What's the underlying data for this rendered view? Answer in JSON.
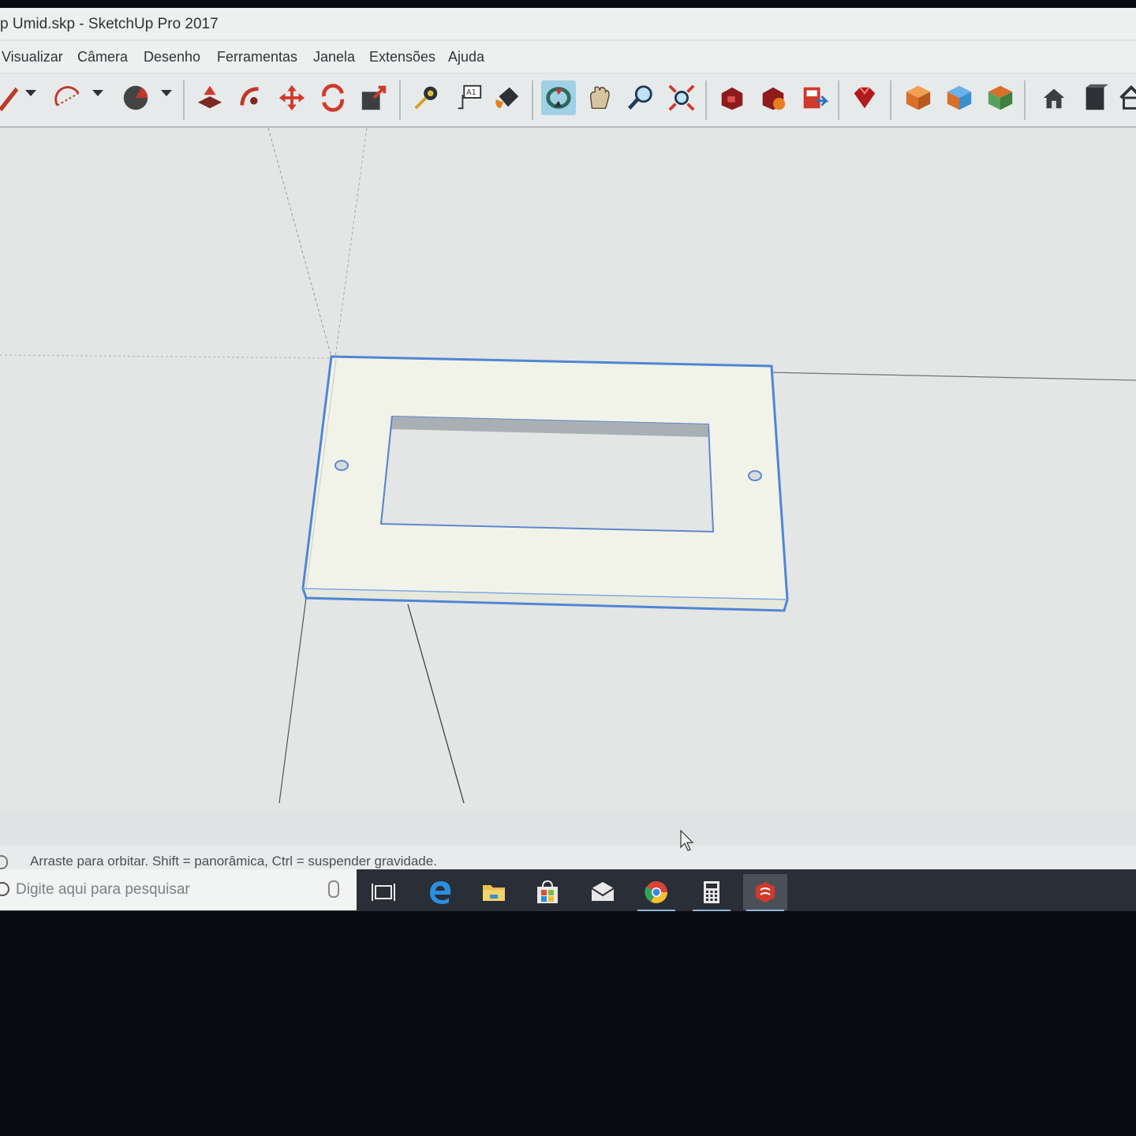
{
  "window": {
    "title": "p Umid.skp - SketchUp Pro 2017"
  },
  "menu": {
    "items": [
      "Visualizar",
      "Câmera",
      "Desenho",
      "Ferramentas",
      "Janela",
      "Extensões",
      "Ajuda"
    ]
  },
  "toolbar": {
    "tools": [
      "pencil-icon",
      "arc-icon",
      "pie-icon",
      "push-pull-icon",
      "follow-me-icon",
      "move-icon",
      "rotate-icon",
      "scale-icon",
      "tape-measure-icon",
      "text-label-icon",
      "paint-bucket-icon",
      "orbit-icon",
      "pan-icon",
      "zoom-icon",
      "zoom-extents-icon",
      "warehouse-icon",
      "extension-warehouse-icon",
      "send-to-layout-icon",
      "ruby-console-icon",
      "iso-view-icon",
      "top-view-icon",
      "front-view-icon",
      "house-icon",
      "box-icon",
      "home-icon"
    ],
    "active_tool": "orbit-icon",
    "select_color": "#4f86d6"
  },
  "status": {
    "hint": "Arraste para orbitar. Shift = panorâmica, Ctrl = suspender gravidade."
  },
  "taskbar": {
    "search_placeholder": "Digite aqui para pesquisar",
    "apps": [
      "task-view-icon",
      "edge-icon",
      "file-explorer-icon",
      "store-icon",
      "mail-icon",
      "chrome-icon",
      "calculator-icon",
      "sketchup-icon"
    ]
  }
}
